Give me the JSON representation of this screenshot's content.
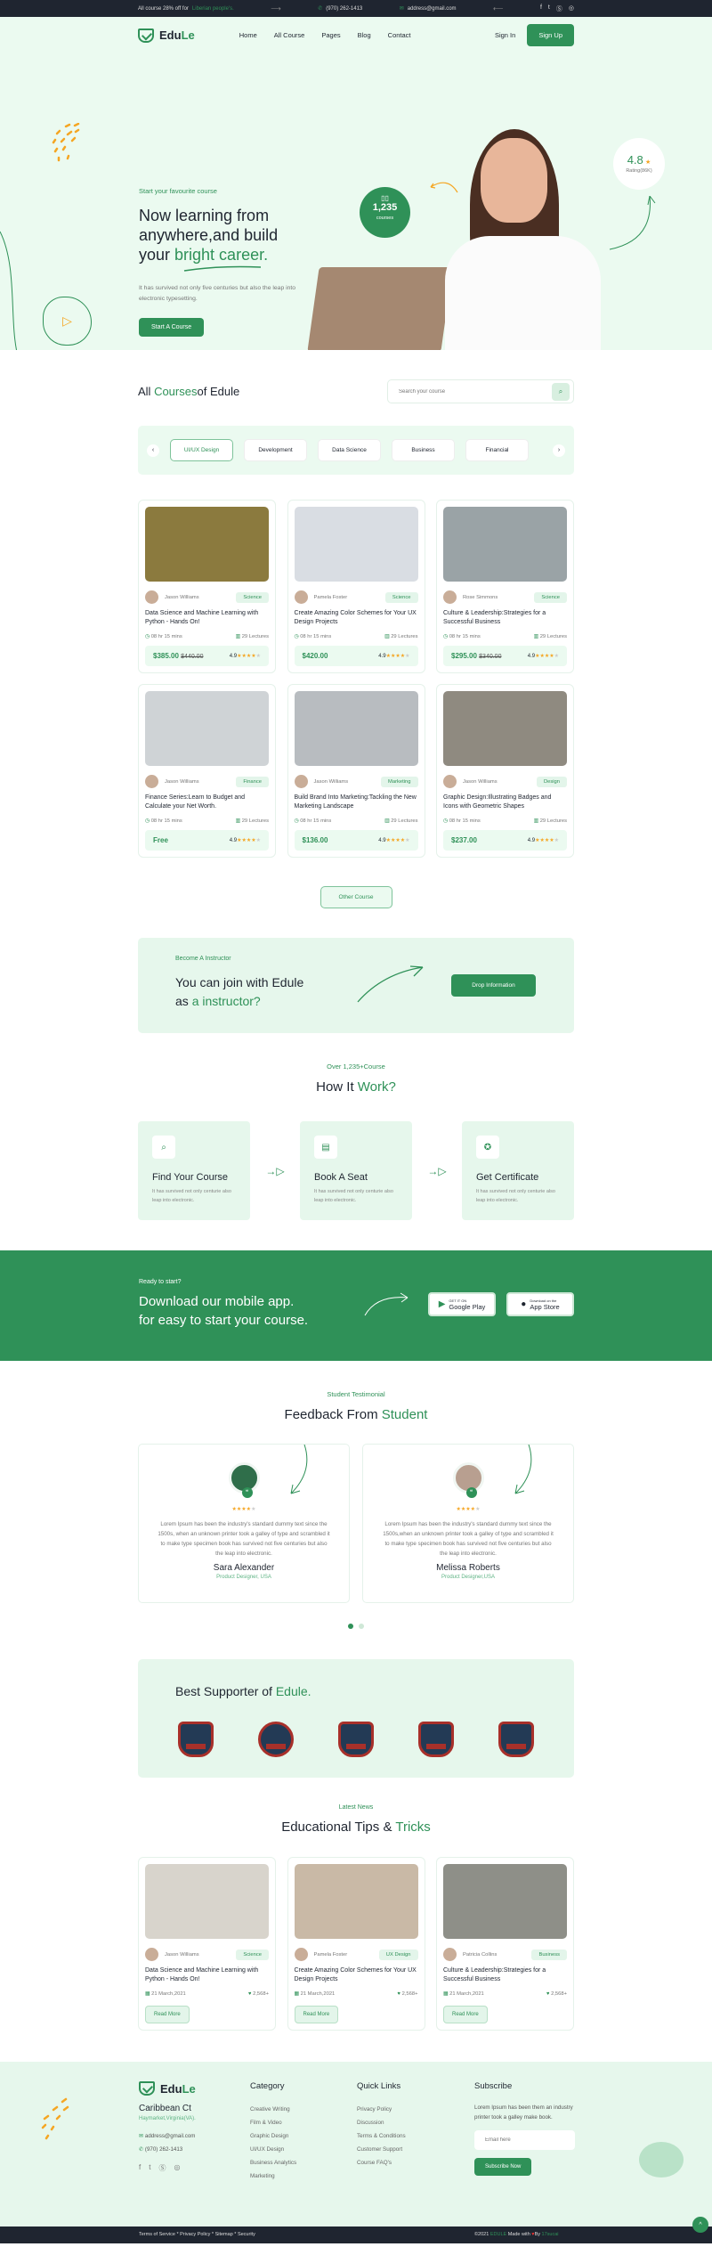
{
  "topbar": {
    "promo_text": "All course 28% off for",
    "promo_highlight": "Liberian people's.",
    "phone": "(970) 262-1413",
    "email": "address@gmail.com",
    "social": [
      "facebook",
      "twitter",
      "skype",
      "instagram"
    ]
  },
  "header": {
    "logo_prefix": "Edu",
    "logo_suffix": "Le",
    "nav": [
      "Home",
      "All Course",
      "Pages",
      "Blog",
      "Contact"
    ],
    "sign_in": "Sign In",
    "sign_up": "Sign Up"
  },
  "hero": {
    "subtitle": "Start your favourite course",
    "title_line1": "Now learning from",
    "title_line2": "anywhere,and build",
    "title_line3_prefix": "your ",
    "title_highlight": "bright career.",
    "description": "It has survived not only five centuries but also the leap into electronic typesetting.",
    "cta": "Start A Course",
    "courses_count": "1,235",
    "courses_label": "courses",
    "rating_value": "4.8",
    "rating_label": "Rating(86K)"
  },
  "courses": {
    "title_prefix": "All ",
    "title_highlight": "Courses",
    "title_suffix": "of Edule",
    "search_placeholder": "Search your course",
    "tabs": [
      "UI/UX Design",
      "Development",
      "Data Science",
      "Business",
      "Financial"
    ],
    "active_tab": "UI/UX Design",
    "items": [
      {
        "instructor": "Jason Williams",
        "tag": "Science",
        "title": "Data Science and Machine Learning with Python - Hands On!",
        "duration": "08 hr 15 mins",
        "lectures": "29 Lectures",
        "price": "$385.00",
        "old_price": "$440.00",
        "rating": "4.9",
        "image_color": "#8b7a3e"
      },
      {
        "instructor": "Pamela Foster",
        "tag": "Science",
        "title": "Create Amazing Color Schemes for Your UX Design Projects",
        "duration": "08 hr 15 mins",
        "lectures": "29 Lectures",
        "price": "$420.00",
        "old_price": "",
        "rating": "4.9",
        "image_color": "#d9dde3"
      },
      {
        "instructor": "Rose Simmons",
        "tag": "Science",
        "title": "Culture & Leadership:Strategies for a Successful Business",
        "duration": "08 hr 15 mins",
        "lectures": "29 Lectures",
        "price": "$295.00",
        "old_price": "$340.00",
        "rating": "4.9",
        "image_color": "#9aa3a6"
      },
      {
        "instructor": "Jason Williams",
        "tag": "Finance",
        "title": "Finance Series:Learn to Budget and Calculate your Net Worth.",
        "duration": "08 hr 15 mins",
        "lectures": "29 Lectures",
        "price": "Free",
        "old_price": "",
        "rating": "4.9",
        "image_color": "#cfd3d6"
      },
      {
        "instructor": "Jason Williams",
        "tag": "Marketing",
        "title": "Build Brand Into Marketing:Tackling the New Marketing Landscape",
        "duration": "08 hr 15 mins",
        "lectures": "29 Lectures",
        "price": "$136.00",
        "old_price": "",
        "rating": "4.9",
        "image_color": "#b8bcc0"
      },
      {
        "instructor": "Jason Williams",
        "tag": "Design",
        "title": "Graphic Design:Illustrating Badges and Icons with Geometric Shapes",
        "duration": "08 hr 15 mins",
        "lectures": "29 Lectures",
        "price": "$237.00",
        "old_price": "",
        "rating": "4.9",
        "image_color": "#8f8a80"
      }
    ],
    "other_button": "Other Course"
  },
  "instructor": {
    "subtitle": "Become A Instructor",
    "title_line1": "You can join with Edule",
    "title_line2_prefix": "as ",
    "title_highlight": "a instructor?",
    "button": "Drop Information"
  },
  "how": {
    "subtitle": "Over 1,235+Course",
    "title_prefix": "How It ",
    "title_highlight": "Work?",
    "steps": [
      {
        "icon": "search-icon",
        "title": "Find Your Course",
        "text": "It has survived not only centurie also leap into electronic."
      },
      {
        "icon": "document-icon",
        "title": "Book A Seat",
        "text": "It has survived not only centurie also leap into electronic."
      },
      {
        "icon": "certificate-icon",
        "title": "Get Certificate",
        "text": "It has survived not only centurie also leap into electronic."
      }
    ]
  },
  "app": {
    "subtitle": "Ready to start?",
    "title_line1": "Download our mobile app.",
    "title_line2": "for easy to start your course.",
    "google_small": "GET IT ON",
    "google_big": "Google Play",
    "apple_small": "Download on the",
    "apple_big": "App Store"
  },
  "testimonials": {
    "subtitle": "Student Testimonial",
    "title_prefix": "Feedback From ",
    "title_highlight": "Student",
    "items": [
      {
        "name": "Sara Alexander",
        "role": "Product Designer, USA",
        "rating": 4,
        "text": "Lorem Ipsum has been the industry's standard dummy text since the 1500s, when an unknown printer took a galley of type and scrambled it to make type specimen book has survived not five centuries but also the leap into electronic."
      },
      {
        "name": "Melissa Roberts",
        "role": "Product Designer,USA",
        "rating": 4,
        "text": "Lorem Ipsum has been the industry's standard dummy text since the 1500s,when an unknown printer took a galley of type and scrambled it to make type specimen book has survived not five centuries but also the leap into electronic."
      }
    ],
    "pages": 2,
    "active_page": 1
  },
  "supporters": {
    "title_prefix": "Best Supporter of ",
    "title_highlight": "Edule.",
    "logos": [
      "university-crest-1",
      "university-crest-2",
      "university-crest-3",
      "university-crest-4",
      "college-crest-5"
    ]
  },
  "news": {
    "subtitle": "Latest News",
    "title_prefix": "Educational Tips & ",
    "title_highlight": "Tricks",
    "items": [
      {
        "author": "Jason Williams",
        "tag": "Science",
        "title": "Data Science and Machine Learning with Python - Hands On!",
        "date": "21 March,2021",
        "likes": "2,568+",
        "button": "Read More",
        "image_color": "#d8d4cc"
      },
      {
        "author": "Pamela Foster",
        "tag": "UX Design",
        "title": "Create Amazing Color Schemes for Your UX Design Projects",
        "date": "21 March,2021",
        "likes": "2,568+",
        "button": "Read More",
        "image_color": "#c9b9a6"
      },
      {
        "author": "Patricia Collins",
        "tag": "Business",
        "title": "Culture & Leadership:Strategies for a Successful Business",
        "date": "21 March,2021",
        "likes": "2,568+",
        "button": "Read More",
        "image_color": "#8e8f88"
      }
    ]
  },
  "footer": {
    "address_title": "Caribbean Ct",
    "address_city": "Haymarket,Virginia(VA).",
    "email": "address@gmail.com",
    "phone": "(970) 262-1413",
    "category_title": "Category",
    "categories": [
      "Creative Writing",
      "Film & Video",
      "Graphic Design",
      "UI/UX Design",
      "Business Analytics",
      "Marketing"
    ],
    "quicklinks_title": "Quick Links",
    "quicklinks": [
      "Privacy Policy",
      "Discussion",
      "Terms & Conditions",
      "Customer Support",
      "Course FAQ's"
    ],
    "subscribe_title": "Subscribe",
    "subscribe_text": "Lorem Ipsum has been them an industry printer took a galley make book.",
    "email_placeholder": "Email here",
    "subscribe_button": "Subscribe Now"
  },
  "bottombar": {
    "links": "Terms of Service * Privacy Policy * Sitemap * Security",
    "copy_prefix": "©2021 ",
    "brand": "EDULE",
    "made_with": " Made with ",
    "by": "By ",
    "author": "17sucai"
  },
  "colors": {
    "accent": "#2f9158",
    "dark": "#1f2530",
    "light_bg": "#ebfaf0",
    "star": "#f5a623"
  }
}
